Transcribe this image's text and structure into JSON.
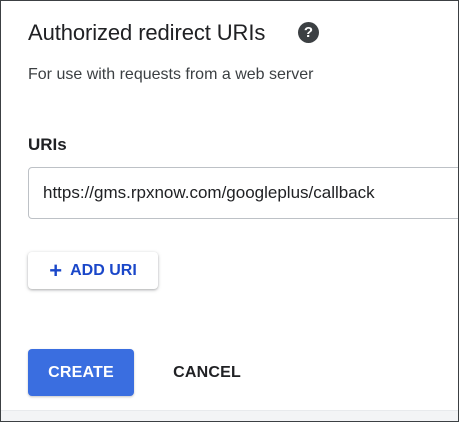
{
  "section": {
    "title": "Authorized redirect URIs",
    "help_icon": "help-icon",
    "subtitle": "For use with requests from a web server"
  },
  "uris": {
    "label": "URIs",
    "items": [
      "https://gms.rpxnow.com/googleplus/callback"
    ]
  },
  "add_uri": {
    "icon": "+",
    "label": "ADD URI"
  },
  "actions": {
    "create_label": "CREATE",
    "cancel_label": "CANCEL"
  },
  "colors": {
    "accent": "#3a6ee0",
    "link": "#1a47c9",
    "text": "#202124"
  }
}
